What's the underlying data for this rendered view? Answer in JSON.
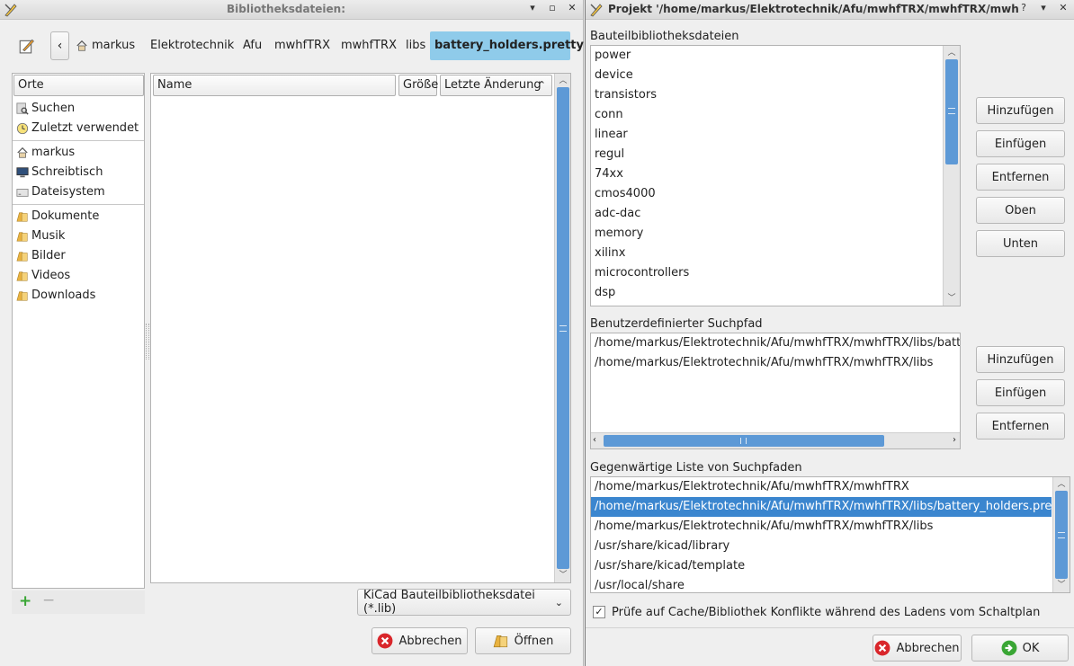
{
  "left_window": {
    "title": "Bibliotheksdateien:",
    "breadcrumbs": [
      "markus",
      "Elektrotechnik",
      "Afu",
      "mwhfTRX",
      "mwhfTRX",
      "libs",
      "battery_holders.pretty"
    ],
    "places_header": "Orte",
    "places": [
      {
        "label": "Suchen",
        "icon": "search-icon"
      },
      {
        "label": "Zuletzt verwendet",
        "icon": "clock-icon"
      },
      {
        "label": "markus",
        "icon": "home-icon"
      },
      {
        "label": "Schreibtisch",
        "icon": "desktop-icon"
      },
      {
        "label": "Dateisystem",
        "icon": "drive-icon"
      },
      {
        "label": "Dokumente",
        "icon": "folder-icon"
      },
      {
        "label": "Musik",
        "icon": "folder-icon"
      },
      {
        "label": "Bilder",
        "icon": "folder-icon"
      },
      {
        "label": "Videos",
        "icon": "folder-icon"
      },
      {
        "label": "Downloads",
        "icon": "folder-icon"
      }
    ],
    "columns": {
      "name": "Name",
      "size": "Größe",
      "modified": "Letzte Änderung"
    },
    "filter": "KiCad Bauteilbibliotheksdatei (*.lib)",
    "cancel_label": "Abbrechen",
    "open_label": "Öffnen"
  },
  "right_window": {
    "title": "Projekt '/home/markus/Elektrotechnik/Afu/mwhfTRX/mwhfTRX/mwhfTRX.pro'",
    "lib_section_label": "Bauteilbibliotheksdateien",
    "libraries": [
      "power",
      "device",
      "transistors",
      "conn",
      "linear",
      "regul",
      "74xx",
      "cmos4000",
      "adc-dac",
      "memory",
      "xilinx",
      "microcontrollers",
      "dsp"
    ],
    "lib_buttons": {
      "add": "Hinzufügen",
      "insert": "Einfügen",
      "remove": "Entfernen",
      "up": "Oben",
      "down": "Unten"
    },
    "user_path_label": "Benutzerdefinierter Suchpfad",
    "user_paths": [
      "/home/markus/Elektrotechnik/Afu/mwhfTRX/mwhfTRX/libs/battery_",
      "/home/markus/Elektrotechnik/Afu/mwhfTRX/mwhfTRX/libs"
    ],
    "path_buttons": {
      "add": "Hinzufügen",
      "insert": "Einfügen",
      "remove": "Entfernen"
    },
    "current_paths_label": "Gegenwärtige Liste von Suchpfaden",
    "current_paths": [
      "/home/markus/Elektrotechnik/Afu/mwhfTRX/mwhfTRX",
      "/home/markus/Elektrotechnik/Afu/mwhfTRX/mwhfTRX/libs/battery_holders.pretty",
      "/home/markus/Elektrotechnik/Afu/mwhfTRX/mwhfTRX/libs",
      "/usr/share/kicad/library",
      "/usr/share/kicad/template",
      "/usr/local/share"
    ],
    "selected_path_index": 1,
    "check_label": "Prüfe auf Cache/Bibliothek Konflikte während des Ladens vom Schaltplan",
    "check_checked": true,
    "cancel_label": "Abbrechen",
    "ok_label": "OK"
  },
  "colors": {
    "selection": "#3b86cf",
    "crumb_active": "#8fcbea",
    "cancel_red": "#d9262b",
    "ok_green": "#3aa635"
  }
}
